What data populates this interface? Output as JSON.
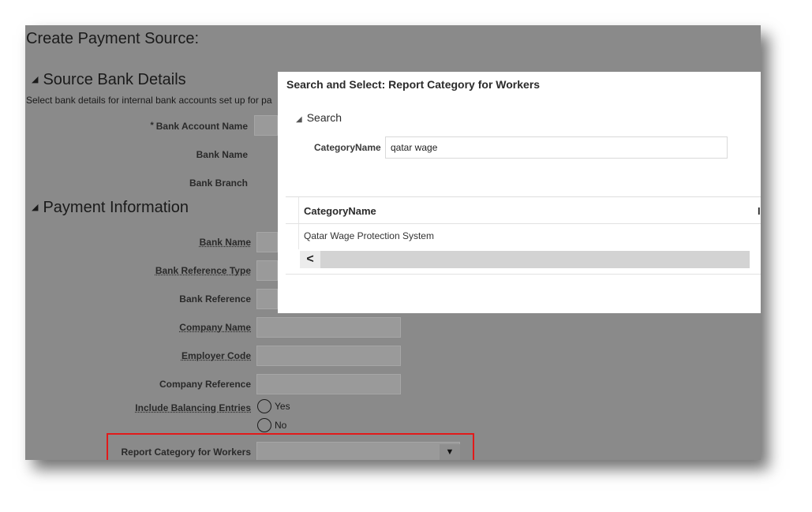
{
  "page": {
    "title": "Create Payment Source:",
    "source_bank": {
      "heading": "Source Bank Details",
      "note": "Select bank details for internal bank accounts set up for pa",
      "required_mark": "*",
      "fields": {
        "bank_account_name": "Bank Account Name",
        "bank_name": "Bank Name",
        "bank_branch": "Bank Branch"
      }
    },
    "payment_info": {
      "heading": "Payment Information",
      "fields": {
        "bank_name": "Bank Name",
        "bank_reference_type": "Bank Reference Type",
        "bank_reference": "Bank Reference",
        "company_name": "Company Name",
        "employer_code": "Employer Code",
        "company_reference": "Company Reference",
        "include_balancing_entries": "Include Balancing Entries",
        "report_category": "Report Category for Workers"
      },
      "radio": {
        "yes": "Yes",
        "no": "No"
      }
    }
  },
  "dialog": {
    "title": "Search and Select: Report Category for Workers",
    "search_section": "Search",
    "field_label": "CategoryName",
    "field_value": "qatar wage",
    "columns": [
      "CategoryName",
      "I"
    ],
    "rows": [
      {
        "category_name": "Qatar Wage Protection System"
      }
    ],
    "scroll_left_glyph": "<"
  },
  "icons": {
    "collapse": "triangle-collapse-icon",
    "dropdown": "dropdown-arrow-icon",
    "scroll_left": "chevron-left-icon"
  },
  "colors": {
    "highlight_box": "#e21a1a",
    "overlay_background": "#8a8a8a"
  }
}
